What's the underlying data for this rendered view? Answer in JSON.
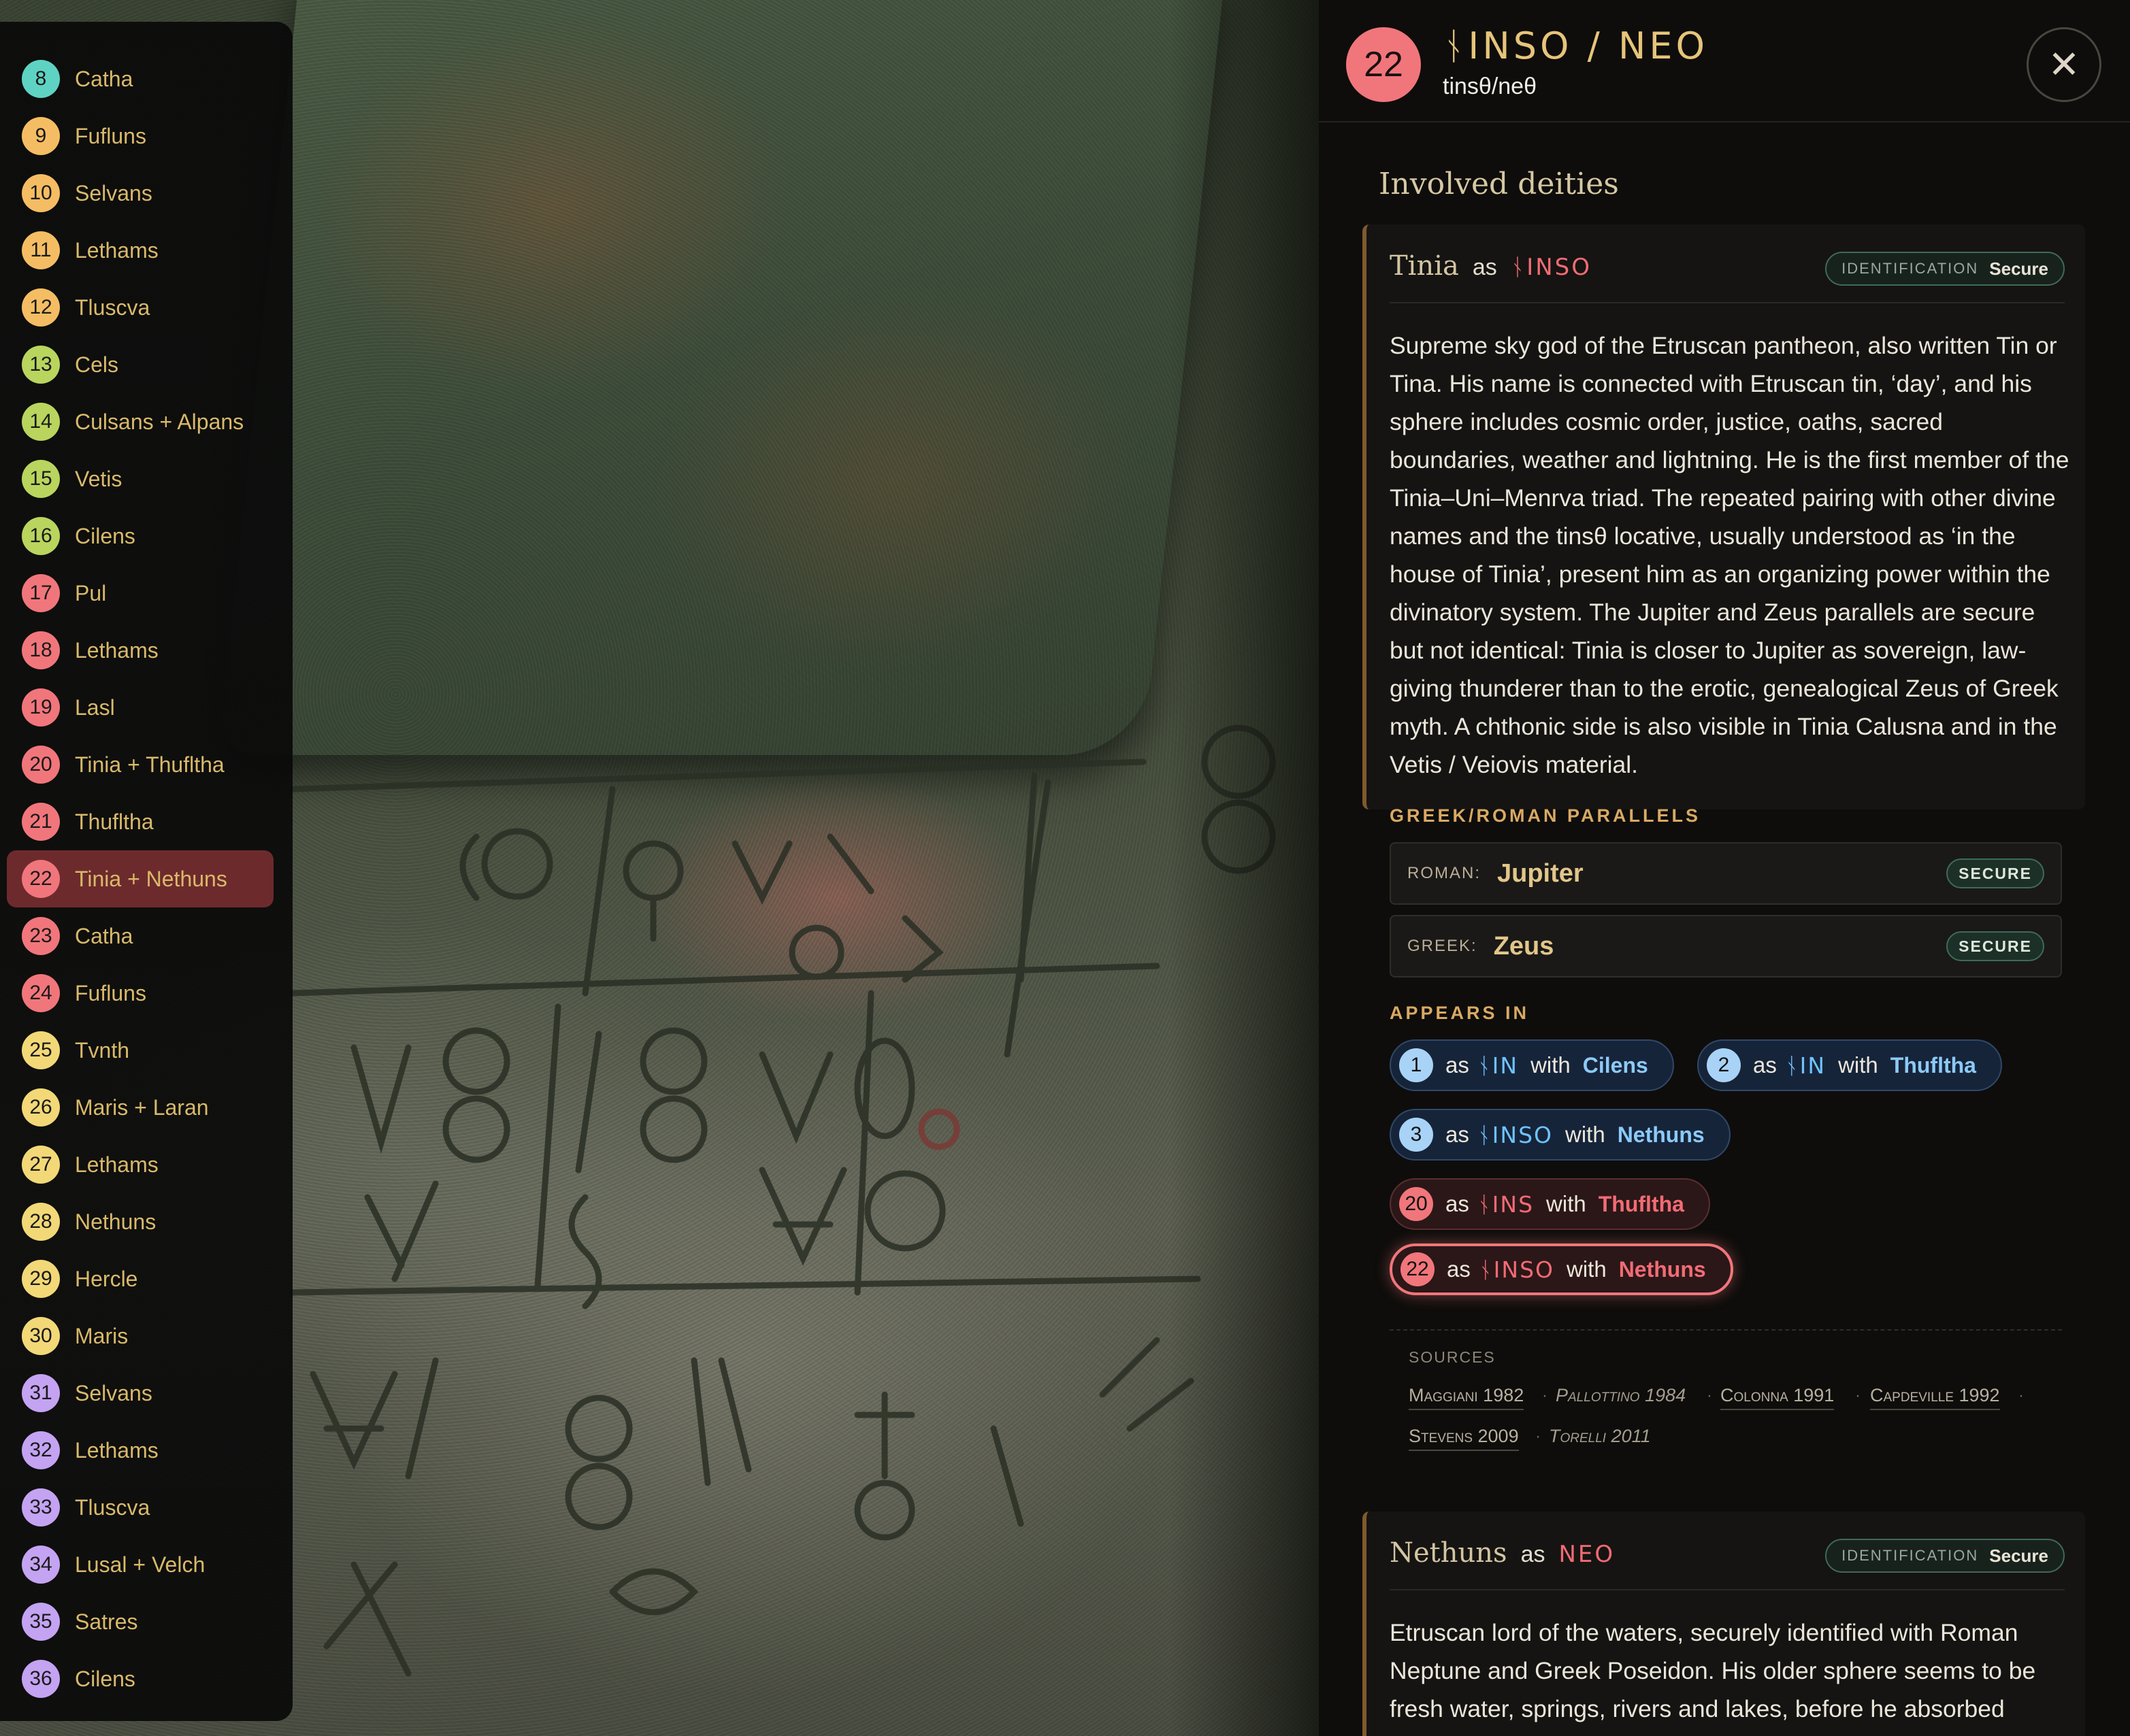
{
  "sidebar": {
    "items": [
      {
        "num": "8",
        "label": "Catha",
        "color": "#5fd3c3"
      },
      {
        "num": "9",
        "label": "Fufluns",
        "color": "#f5bd63"
      },
      {
        "num": "10",
        "label": "Selvans",
        "color": "#f5bd63"
      },
      {
        "num": "11",
        "label": "Lethams",
        "color": "#f5bd63"
      },
      {
        "num": "12",
        "label": "Tluscva",
        "color": "#f5bd63"
      },
      {
        "num": "13",
        "label": "Cels",
        "color": "#b9d55e"
      },
      {
        "num": "14",
        "label": "Culsans + Alpans",
        "color": "#b9d55e"
      },
      {
        "num": "15",
        "label": "Vetis",
        "color": "#b9d55e"
      },
      {
        "num": "16",
        "label": "Cilens",
        "color": "#b9d55e"
      },
      {
        "num": "17",
        "label": "Pul",
        "color": "#f1767b"
      },
      {
        "num": "18",
        "label": "Lethams",
        "color": "#f1767b"
      },
      {
        "num": "19",
        "label": "Lasl",
        "color": "#f1767b"
      },
      {
        "num": "20",
        "label": "Tinia + Thufltha",
        "color": "#f1767b"
      },
      {
        "num": "21",
        "label": "Thufltha",
        "color": "#f1767b"
      },
      {
        "num": "22",
        "label": "Tinia + Nethuns",
        "color": "#f1767b"
      },
      {
        "num": "23",
        "label": "Catha",
        "color": "#f1767b"
      },
      {
        "num": "24",
        "label": "Fufluns",
        "color": "#f1767b"
      },
      {
        "num": "25",
        "label": "Tvnth",
        "color": "#f3d877"
      },
      {
        "num": "26",
        "label": "Maris + Laran",
        "color": "#f3d877"
      },
      {
        "num": "27",
        "label": "Lethams",
        "color": "#f3d877"
      },
      {
        "num": "28",
        "label": "Nethuns",
        "color": "#f3d877"
      },
      {
        "num": "29",
        "label": "Hercle",
        "color": "#f3d877"
      },
      {
        "num": "30",
        "label": "Maris",
        "color": "#f3d877"
      },
      {
        "num": "31",
        "label": "Selvans",
        "color": "#c4a3f2"
      },
      {
        "num": "32",
        "label": "Lethams",
        "color": "#c4a3f2"
      },
      {
        "num": "33",
        "label": "Tluscva",
        "color": "#c4a3f2"
      },
      {
        "num": "34",
        "label": "Lusal + Velch",
        "color": "#c4a3f2"
      },
      {
        "num": "35",
        "label": "Satres",
        "color": "#c4a3f2"
      },
      {
        "num": "36",
        "label": "Cilens",
        "color": "#c4a3f2"
      }
    ],
    "active_num": "22"
  },
  "panel": {
    "badge_num": "22",
    "title_etruscan": "ᚾINSO / NEO",
    "subtitle": "tinsθ/neθ",
    "close_label": "✕",
    "section_heading": "Involved deities"
  },
  "tinia": {
    "name": "Tinia",
    "as": "as",
    "etruscan": "ᚾINSO",
    "identification_key": "IDENTIFICATION",
    "identification_value": "Secure",
    "description": "Supreme sky god of the Etruscan pantheon, also written Tin or Tina. His name is connected with Etruscan tin, ‘day’, and his sphere includes cosmic order, justice, oaths, sacred boundaries, weather and lightning. He is the first member of the Tinia–Uni–Menrva triad. The repeated pairing with other divine names and the tinsθ locative, usually understood as ‘in the house of Tinia’, present him as an organizing power within the divinatory system. The Jupiter and Zeus parallels are secure but not identical: Tinia is closer to Jupiter as sovereign, law-giving thunderer than to the erotic, genealogical Zeus of Greek myth. A chthonic side is also visible in Tinia Calusna and in the Vetis / Veiovis material.",
    "parallels_heading": "GREEK/ROMAN PARALLELS",
    "parallels": [
      {
        "key": "ROMAN:",
        "value": "Jupiter",
        "badge": "SECURE"
      },
      {
        "key": "GREEK:",
        "value": "Zeus",
        "badge": "SECURE"
      }
    ],
    "appears_heading": "APPEARS IN",
    "appears": [
      {
        "num": "1",
        "as": "as",
        "etr": "ᚾIN",
        "with": "with",
        "partner": "Cilens"
      },
      {
        "num": "2",
        "as": "as",
        "etr": "ᚾIN",
        "with": "with",
        "partner": "Thufltha"
      },
      {
        "num": "3",
        "as": "as",
        "etr": "ᚾINSO",
        "with": "with",
        "partner": "Nethuns"
      },
      {
        "num": "20",
        "as": "as",
        "etr": "ᚾINS",
        "with": "with",
        "partner": "Thufltha"
      },
      {
        "num": "22",
        "as": "as",
        "etr": "ᚾINSO",
        "with": "with",
        "partner": "Nethuns"
      }
    ],
    "sources_label": "SOURCES",
    "sources": [
      "Maggiani 1982",
      "Pallottino 1984",
      "Colonna 1991",
      "Capdeville 1992",
      "Stevens 2009",
      "Torelli 2011"
    ],
    "source_sep": "·"
  },
  "nethuns": {
    "name": "Nethuns",
    "as": "as",
    "etruscan": "NEO",
    "identification_key": "IDENTIFICATION",
    "identification_value": "Secure",
    "description": "Etruscan lord of the waters, securely identified with Roman Neptune and Greek Poseidon. His older sphere seems to be fresh water, springs, rivers and lakes, before he absorbed"
  },
  "colors": {
    "accent_gold": "#e6c47a",
    "accent_red": "#f1767b",
    "accent_blue": "#6ec3ff",
    "card_border": "#7e5a2e"
  }
}
